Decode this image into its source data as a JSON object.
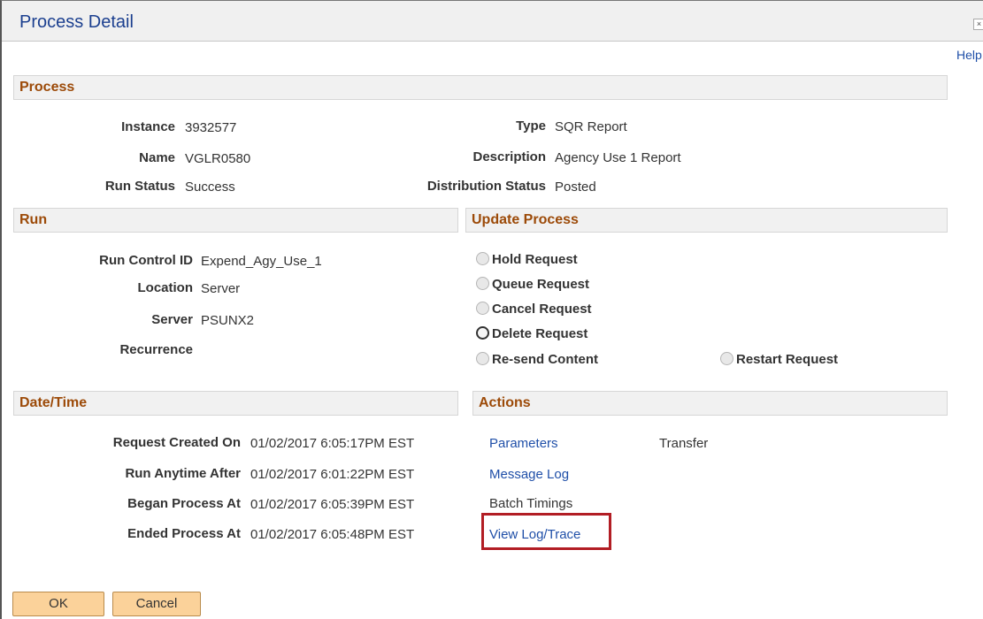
{
  "window": {
    "title": "Process Detail",
    "close_glyph": "×",
    "help_label": "Help"
  },
  "process": {
    "heading": "Process",
    "instance_label": "Instance",
    "instance_value": "3932577",
    "name_label": "Name",
    "name_value": "VGLR0580",
    "run_status_label": "Run Status",
    "run_status_value": "Success",
    "type_label": "Type",
    "type_value": "SQR Report",
    "description_label": "Description",
    "description_value": "Agency Use 1 Report",
    "distribution_status_label": "Distribution Status",
    "distribution_status_value": "Posted"
  },
  "run": {
    "heading": "Run",
    "run_control_label": "Run Control ID",
    "run_control_value": "Expend_Agy_Use_1",
    "location_label": "Location",
    "location_value": "Server",
    "server_label": "Server",
    "server_value": "PSUNX2",
    "recurrence_label": "Recurrence"
  },
  "update_process": {
    "heading": "Update Process",
    "hold": "Hold Request",
    "queue": "Queue Request",
    "cancel": "Cancel Request",
    "delete": "Delete Request",
    "resend": "Re-send Content",
    "restart": "Restart Request"
  },
  "datetime": {
    "heading": "Date/Time",
    "request_created_label": "Request Created On",
    "request_created_value": "01/02/2017  6:05:17PM EST",
    "run_anytime_label": "Run Anytime After",
    "run_anytime_value": "01/02/2017  6:01:22PM EST",
    "began_label": "Began Process At",
    "began_value": "01/02/2017  6:05:39PM EST",
    "ended_label": "Ended Process At",
    "ended_value": "01/02/2017  6:05:48PM EST"
  },
  "actions": {
    "heading": "Actions",
    "parameters": "Parameters",
    "transfer": "Transfer",
    "message_log": "Message Log",
    "batch_timings": "Batch Timings",
    "view_log_trace": "View Log/Trace"
  },
  "buttons": {
    "ok": "OK",
    "cancel": "Cancel"
  },
  "colors": {
    "section_heading": "#9c4a08",
    "link": "#1f4fa8",
    "highlight": "#b21d24",
    "button": "#fbd29a"
  }
}
